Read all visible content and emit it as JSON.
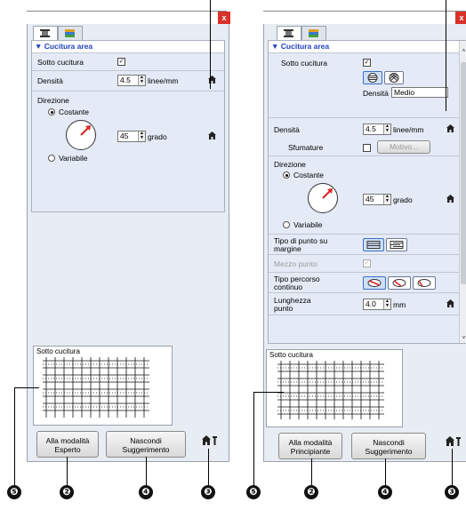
{
  "left": {
    "close_label": "x",
    "section_title": "Cucitura area",
    "sotto_cucitura": "Sotto cucitura",
    "densita": "Densità",
    "densita_value": "4.5",
    "densita_unit": "linee/mm",
    "direzione": "Direzione",
    "costante": "Costante",
    "angle_value": "45",
    "angle_unit": "grado",
    "variabile": "Variabile",
    "preview_label": "Sotto cucitura",
    "mode_button": "Alla modalità Esperto",
    "mode_button_l1": "Alla modalità",
    "mode_button_l2": "Esperto",
    "hints_button_l1": "Nascondi",
    "hints_button_l2": "Suggerimento"
  },
  "right": {
    "close_label": "x",
    "section_title": "Cucitura area",
    "sotto_cucitura": "Sotto cucitura",
    "densita_sub_label": "Densità",
    "densita_sub_value": "Medio",
    "densita": "Densità",
    "densita_value": "4.5",
    "densita_unit": "linee/mm",
    "sfumature": "Sfumature",
    "motivo_button": "Motivo...",
    "direzione": "Direzione",
    "costante": "Costante",
    "angle_value": "45",
    "angle_unit": "grado",
    "variabile": "Variabile",
    "tipo_punto_l1": "Tipo di punto su",
    "tipo_punto_l2": "margine",
    "mezzo_punto": "Mezzo punto",
    "tipo_percorso_l1": "Tipo percorso",
    "tipo_percorso_l2": "continuo",
    "lunghezza_l1": "Lunghezza",
    "lunghezza_l2": "punto",
    "lunghezza_value": "4.0",
    "lunghezza_unit": "mm",
    "preview_label": "Sotto cucitura",
    "mode_button_l1": "Alla modalità",
    "mode_button_l2": "Principiante",
    "hints_button_l1": "Nascondi",
    "hints_button_l2": "Suggerimento"
  },
  "callouts": {
    "n5": "❺",
    "n2": "❷",
    "n4": "❹",
    "n3": "❸"
  },
  "colors": {
    "accent": "#1f3fbf",
    "close": "#d9302a",
    "row_highlight": "#e4eaf6"
  }
}
